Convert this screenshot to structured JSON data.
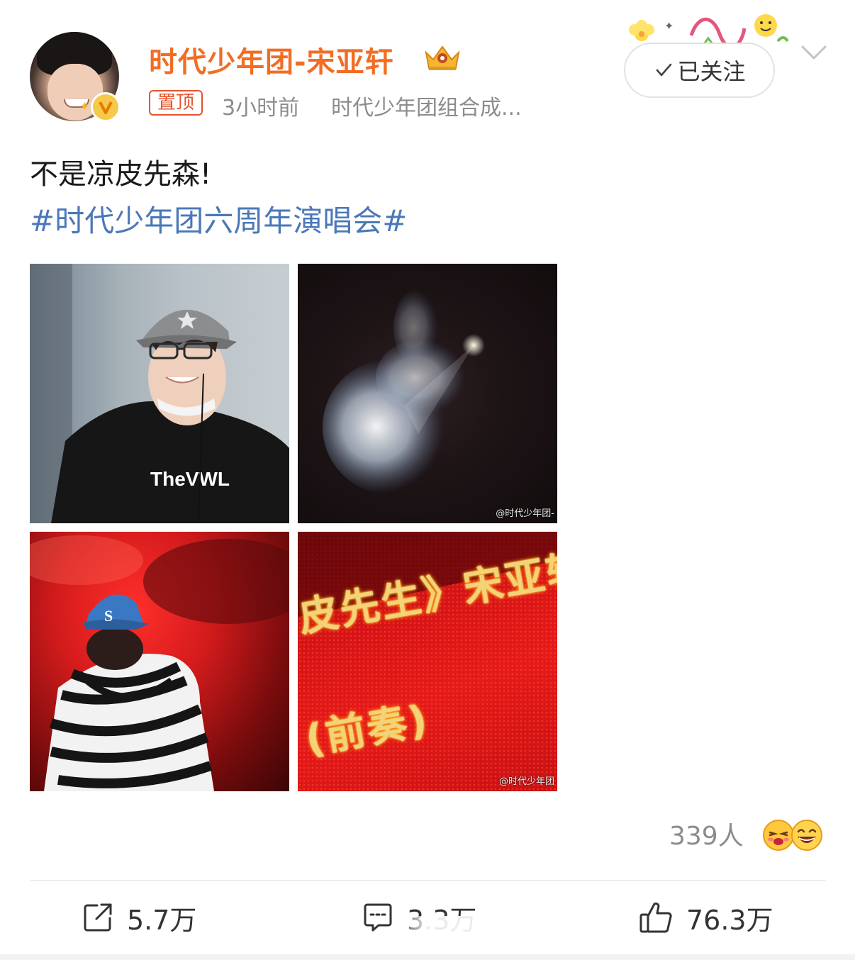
{
  "post": {
    "username": "时代少年团-宋亚轩",
    "pin_label": "置顶",
    "time": "3小时前",
    "source": "时代少年团组合成...",
    "follow_label": "已关注",
    "text": "不是凉皮先森!",
    "hashtag": "#时代少年团六周年演唱会#"
  },
  "images": {
    "shirt_text": "TheVWL",
    "cap_letter": "S",
    "led_line1": "皮先生》宋亚轩",
    "led_line2": "(前奏)",
    "watermark_2": "@时代少年团-",
    "watermark_4": "@时代少年团"
  },
  "reactions": {
    "count_label": "339人"
  },
  "actions": {
    "repost": "5.7万",
    "comment": "3.3万",
    "like": "76.3万"
  },
  "colors": {
    "username": "#f26d23",
    "pin": "#e5532d",
    "hashtag": "#4a78b8",
    "meta": "#8c8c8c"
  },
  "icons": {
    "verify": "verified-v-badge-icon",
    "crown": "crown-icon",
    "follow_check": "check-icon",
    "more": "chevron-down-icon",
    "repost": "repost-icon",
    "comment": "comment-icon",
    "like": "thumbs-up-icon"
  }
}
